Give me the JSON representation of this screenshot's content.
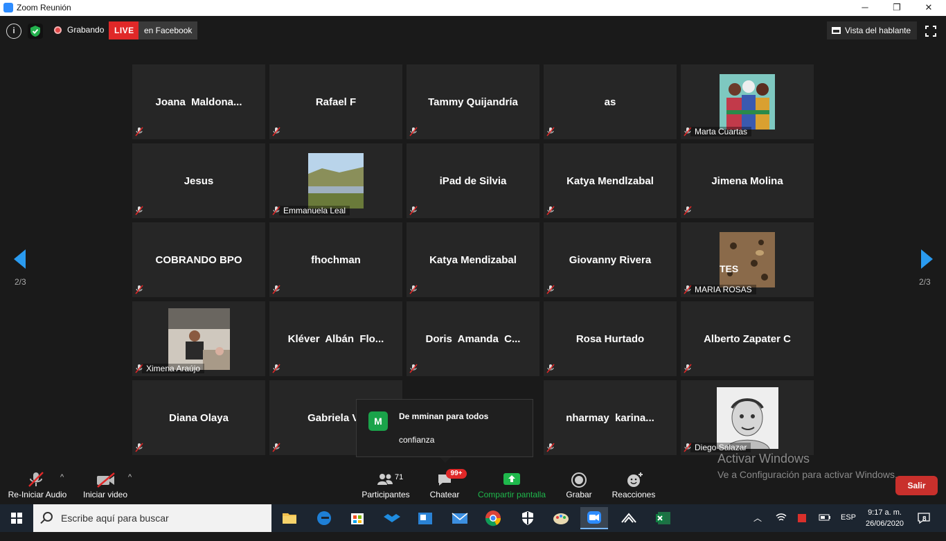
{
  "window": {
    "title": "Zoom Reunión",
    "minimize": "─",
    "maximize": "❐",
    "close": "✕"
  },
  "topbar": {
    "info": "i",
    "recording": "Grabando",
    "live": "LIVE",
    "live_platform": "en Facebook",
    "view_mode": "Vista del hablante"
  },
  "pager": {
    "left": "2/3",
    "right": "2/3"
  },
  "participants": [
    {
      "name": "Joana  Maldona...",
      "caption": "",
      "photo": ""
    },
    {
      "name": "Rafael F",
      "caption": "",
      "photo": ""
    },
    {
      "name": "Tammy Quijandría",
      "caption": "",
      "photo": ""
    },
    {
      "name": "as",
      "caption": "",
      "photo": ""
    },
    {
      "name": "",
      "caption": "Marta Cuartas",
      "photo": "painting"
    },
    {
      "name": "Jesus",
      "caption": "",
      "photo": ""
    },
    {
      "name": "",
      "caption": "Emmanuela Leal",
      "photo": "landscape"
    },
    {
      "name": "iPad de Silvia",
      "caption": "",
      "photo": ""
    },
    {
      "name": "Katya Mendlzabal",
      "caption": "",
      "photo": ""
    },
    {
      "name": "Jimena Molina",
      "caption": "",
      "photo": ""
    },
    {
      "name": "COBRANDO BPO",
      "caption": "",
      "photo": ""
    },
    {
      "name": "fhochman",
      "caption": "",
      "photo": ""
    },
    {
      "name": "Katya Mendizabal",
      "caption": "",
      "photo": ""
    },
    {
      "name": "Giovanny Rivera",
      "caption": "",
      "photo": ""
    },
    {
      "name": "",
      "caption": "MARIA ROSAS",
      "photo": "leopard"
    },
    {
      "name": "",
      "caption": "Ximena Araújo",
      "photo": "person"
    },
    {
      "name": "Klév­er  Albán  Flo...",
      "caption": "",
      "photo": ""
    },
    {
      "name": "Doris  Amanda  C...",
      "caption": "",
      "photo": ""
    },
    {
      "name": "Rosa Hurtado",
      "caption": "",
      "photo": ""
    },
    {
      "name": "Alberto Zapater C",
      "caption": "",
      "photo": ""
    },
    {
      "name": "Diana Olaya",
      "caption": "",
      "photo": ""
    },
    {
      "name": "Gabriela Va",
      "caption": "",
      "photo": ""
    },
    {
      "name": "",
      "caption": "",
      "photo": ""
    },
    {
      "name": "nharmay  karina...",
      "caption": "",
      "photo": ""
    },
    {
      "name": "",
      "caption": "Diego Salazar",
      "photo": "sketch"
    }
  ],
  "chat_popup": {
    "avatar": "M",
    "from": "De mminan para todos",
    "message": "confianza"
  },
  "watermark": {
    "title": "Activar Windows",
    "subtitle": "Ve a Configuración para activar Windows."
  },
  "toolbar": {
    "audio": "Re-Iniciar Audio",
    "video": "Iniciar video",
    "participants": "Participantes",
    "participants_count": "71",
    "chat": "Chatear",
    "chat_badge": "99+",
    "share": "Compartir pantalla",
    "record": "Grabar",
    "reactions": "Reacciones",
    "leave": "Salir"
  },
  "colors": {
    "share": "#1fb84c",
    "live": "#e02828",
    "arrow": "#2a9bf0",
    "leave": "#c9302c"
  },
  "taskbar": {
    "search_placeholder": "Escribe aquí para buscar",
    "language": "ESP",
    "time": "9:17 a. m.",
    "date": "26/06/2020",
    "notifications": "8"
  }
}
